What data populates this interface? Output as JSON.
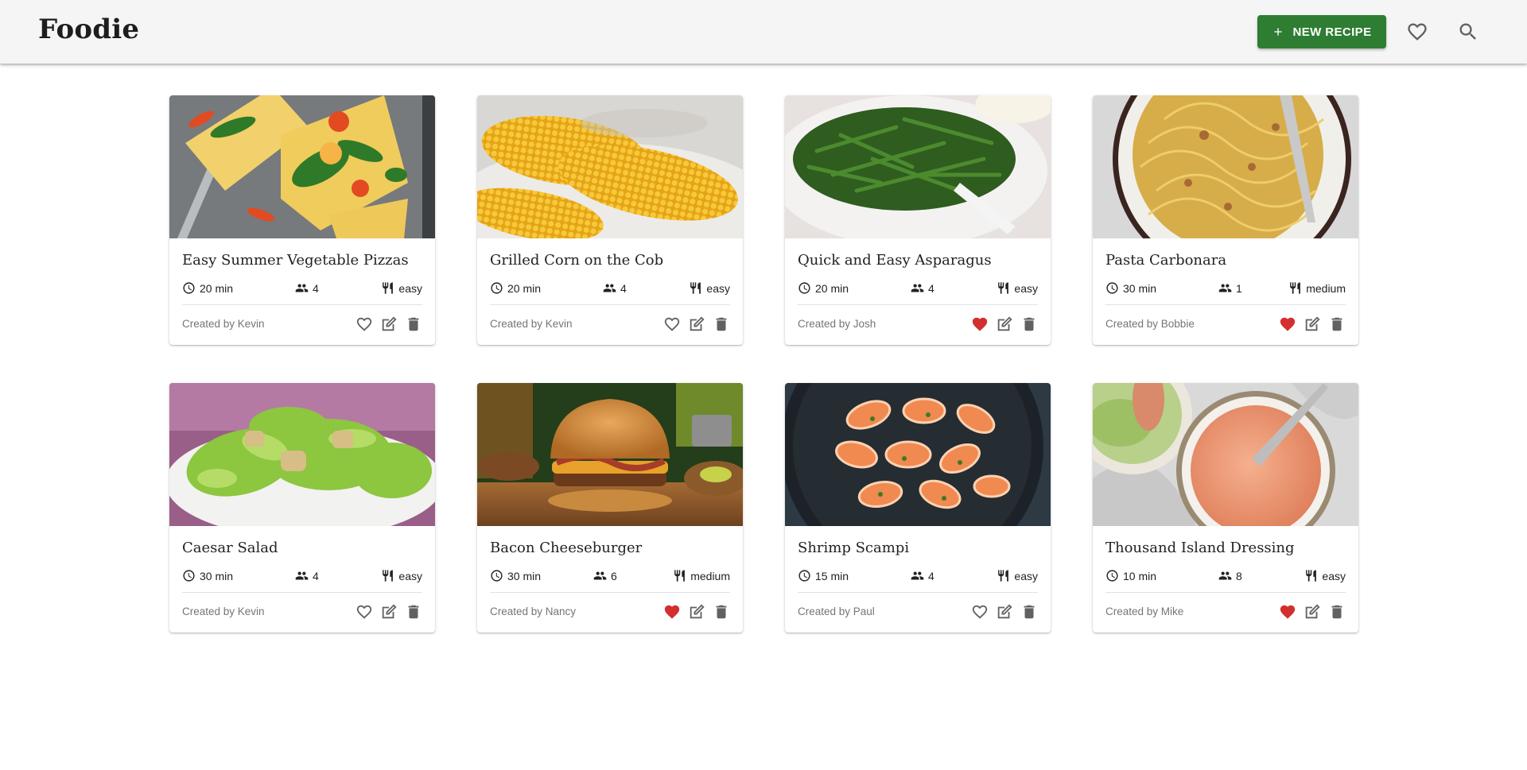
{
  "app": {
    "title": "Foodie"
  },
  "header": {
    "new_recipe_label": "NEW RECIPE"
  },
  "colors": {
    "appbar": "#f5f5f5",
    "accent_green": "#2e7d32",
    "favorite_red": "#d32f2f",
    "icon_gray": "#616161"
  },
  "recipes": [
    {
      "title": "Easy Summer Vegetable Pizzas",
      "time": "20 min",
      "servings": "4",
      "difficulty": "easy",
      "creator": "Created by Kevin",
      "favorite": false
    },
    {
      "title": "Grilled Corn on the Cob",
      "time": "20 min",
      "servings": "4",
      "difficulty": "easy",
      "creator": "Created by Kevin",
      "favorite": false
    },
    {
      "title": "Quick and Easy Asparagus",
      "time": "20 min",
      "servings": "4",
      "difficulty": "easy",
      "creator": "Created by Josh",
      "favorite": true
    },
    {
      "title": "Pasta Carbonara",
      "time": "30 min",
      "servings": "1",
      "difficulty": "medium",
      "creator": "Created by Bobbie",
      "favorite": true
    },
    {
      "title": "Caesar Salad",
      "time": "30 min",
      "servings": "4",
      "difficulty": "easy",
      "creator": "Created by Kevin",
      "favorite": false
    },
    {
      "title": "Bacon Cheeseburger",
      "time": "30 min",
      "servings": "6",
      "difficulty": "medium",
      "creator": "Created by Nancy",
      "favorite": true
    },
    {
      "title": "Shrimp Scampi",
      "time": "15 min",
      "servings": "4",
      "difficulty": "easy",
      "creator": "Created by Paul",
      "favorite": false
    },
    {
      "title": "Thousand Island Dressing",
      "time": "10 min",
      "servings": "8",
      "difficulty": "easy",
      "creator": "Created by Mike",
      "favorite": true
    }
  ]
}
